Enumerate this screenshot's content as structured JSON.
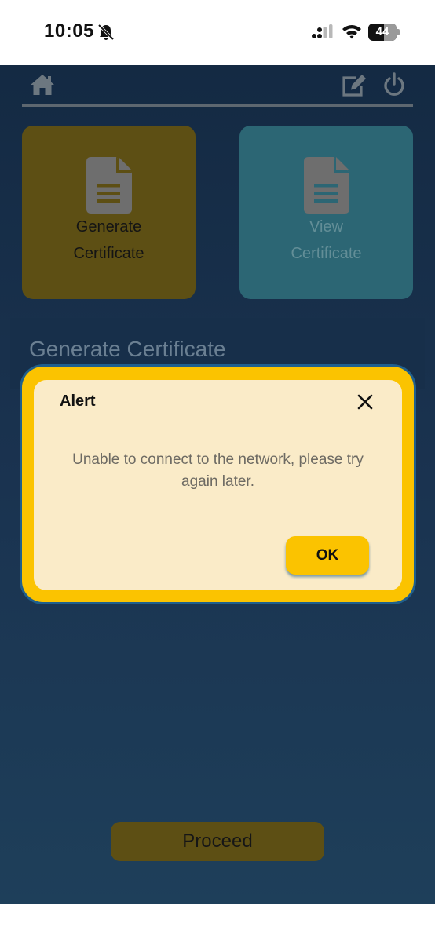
{
  "status_bar": {
    "time": "10:05",
    "battery_level": "44",
    "icons": [
      "bell-slash-icon",
      "cellular-signal-icon",
      "wifi-icon",
      "battery-icon"
    ]
  },
  "header": {
    "icons": [
      "home-icon",
      "edit-icon",
      "power-icon"
    ]
  },
  "tiles": [
    {
      "label_line1": "Generate",
      "label_line2": "Certificate",
      "color": "#5d4f14",
      "icon": "document-icon"
    },
    {
      "label_line1": "View",
      "label_line2": "Certificate",
      "color": "#2c6674",
      "icon": "document-icon"
    }
  ],
  "section": {
    "title": "Generate Certificate"
  },
  "proceed": {
    "label": "Proceed",
    "color": "#5d4f14"
  },
  "alert": {
    "title": "Alert",
    "message": "Unable to connect to the network, please try again later.",
    "ok_label": "OK",
    "accent": "#fbc300",
    "background": "#faebc8",
    "icon": "close-icon"
  }
}
